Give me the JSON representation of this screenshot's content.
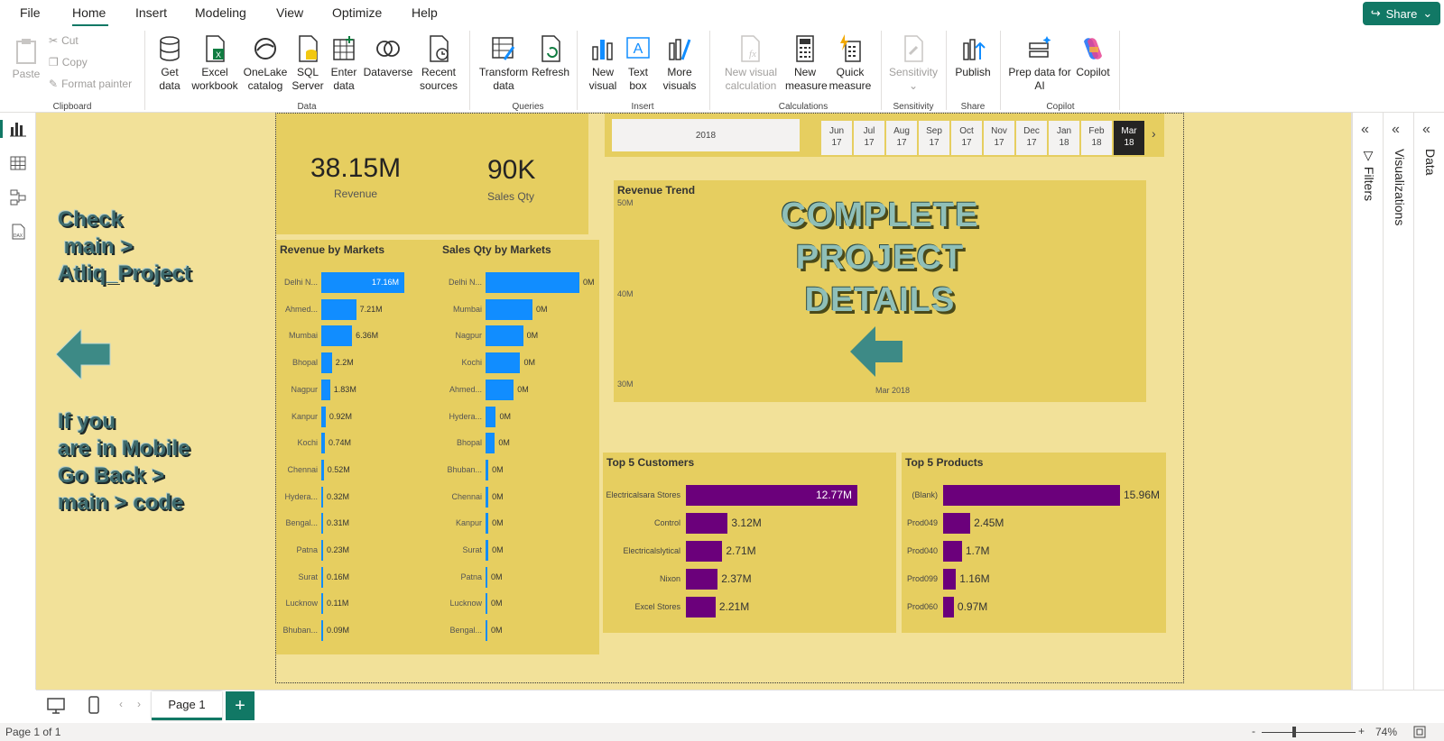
{
  "menu": {
    "file": "File",
    "home": "Home",
    "insert": "Insert",
    "modeling": "Modeling",
    "view": "View",
    "optimize": "Optimize",
    "help": "Help",
    "share": "Share"
  },
  "ribbon": {
    "paste": "Paste",
    "cut": "Cut",
    "copy": "Copy",
    "format_painter": "Format painter",
    "clipboard": "Clipboard",
    "get_data_1": "Get",
    "get_data_2": "data",
    "excel_1": "Excel",
    "excel_2": "workbook",
    "onelake_1": "OneLake",
    "onelake_2": "catalog",
    "sql_1": "SQL",
    "sql_2": "Server",
    "enter_1": "Enter",
    "enter_2": "data",
    "dataverse": "Dataverse",
    "recent_1": "Recent",
    "recent_2": "sources",
    "data_group": "Data",
    "transform_1": "Transform",
    "transform_2": "data",
    "refresh": "Refresh",
    "queries": "Queries",
    "new_visual_1": "New",
    "new_visual_2": "visual",
    "text_box_1": "Text",
    "text_box_2": "box",
    "more_visuals_1": "More",
    "more_visuals_2": "visuals",
    "insert_group": "Insert",
    "new_visual_calc_1": "New visual",
    "new_visual_calc_2": "calculation",
    "new_measure_1": "New",
    "new_measure_2": "measure",
    "quick_measure_1": "Quick",
    "quick_measure_2": "measure",
    "calculations": "Calculations",
    "sensitivity_btn": "Sensitivity",
    "sensitivity": "Sensitivity",
    "publish": "Publish",
    "share_group": "Share",
    "prep_1": "Prep data for",
    "prep_2": "AI",
    "copilot_btn": "Copilot",
    "copilot_group": "Copilot"
  },
  "report": {
    "kpi_revenue": "38.15M",
    "kpi_revenue_label": "Revenue",
    "kpi_qty": "90K",
    "kpi_qty_label": "Sales Qty",
    "year_slicer": "2018",
    "months": [
      [
        "Jun",
        "17"
      ],
      [
        "Jul",
        "17"
      ],
      [
        "Aug",
        "17"
      ],
      [
        "Sep",
        "17"
      ],
      [
        "Oct",
        "17"
      ],
      [
        "Nov",
        "17"
      ],
      [
        "Dec",
        "17"
      ],
      [
        "Jan",
        "18"
      ],
      [
        "Feb",
        "18"
      ],
      [
        "Mar",
        "18"
      ]
    ],
    "selected_month_index": 9,
    "note_left_1": "Check\n main >\nAtliq_Project",
    "note_left_2": "If you\nare in Mobile\nGo Back >\nmain > code",
    "project_text": "COMPLETE\nPROJECT\nDETAILS",
    "trend_title": "Revenue Trend",
    "trend_y": [
      "50M",
      "40M",
      "30M"
    ],
    "trend_x": "Mar 2018",
    "rev_markets_title": "Revenue by Markets",
    "qty_markets_title": "Sales Qty by Markets",
    "top_customers_title": "Top 5 Customers",
    "top_products_title": "Top 5 Products",
    "page_tab": "Page 1",
    "status": "Page 1 of 1",
    "zoom": "74%",
    "pane_filters": "Filters",
    "pane_visualizations": "Visualizations",
    "pane_data": "Data"
  },
  "chart_data": [
    {
      "type": "bar",
      "title": "Revenue by Markets",
      "categories": [
        "Delhi N...",
        "Ahmed...",
        "Mumbai",
        "Bhopal",
        "Nagpur",
        "Kanpur",
        "Kochi",
        "Chennai",
        "Hydera...",
        "Bengal...",
        "Patna",
        "Surat",
        "Lucknow",
        "Bhuban..."
      ],
      "values": [
        17.16,
        7.21,
        6.36,
        2.2,
        1.83,
        0.92,
        0.74,
        0.52,
        0.32,
        0.31,
        0.23,
        0.16,
        0.11,
        0.09
      ],
      "labels": [
        "17.16M",
        "7.21M",
        "6.36M",
        "2.2M",
        "1.83M",
        "0.92M",
        "0.74M",
        "0.52M",
        "0.32M",
        "0.31M",
        "0.23M",
        "0.16M",
        "0.11M",
        "0.09M"
      ],
      "color": "#118dff"
    },
    {
      "type": "bar",
      "title": "Sales Qty by Markets",
      "categories": [
        "Delhi N...",
        "Mumbai",
        "Nagpur",
        "Kochi",
        "Ahmed...",
        "Hydera...",
        "Bhopal",
        "Bhuban...",
        "Chennai",
        "Kanpur",
        "Surat",
        "Patna",
        "Lucknow",
        "Bengal..."
      ],
      "values": [
        100,
        50,
        40,
        37,
        30,
        11,
        10,
        3,
        3,
        3,
        3,
        0.5,
        0.5,
        0.5
      ],
      "labels": [
        "0M",
        "0M",
        "0M",
        "0M",
        "0M",
        "0M",
        "0M",
        "0M",
        "0M",
        "0M",
        "0M",
        "0M",
        "0M",
        "0M"
      ],
      "color": "#118dff"
    },
    {
      "type": "bar",
      "title": "Top 5 Customers",
      "categories": [
        "Electricalsara Stores",
        "Control",
        "Electricalslytical",
        "Nixon",
        "Excel Stores"
      ],
      "values": [
        12.77,
        3.12,
        2.71,
        2.37,
        2.21
      ],
      "labels": [
        "12.77M",
        "3.12M",
        "2.71M",
        "2.37M",
        "2.21M"
      ],
      "color": "#6b007b"
    },
    {
      "type": "bar",
      "title": "Top 5 Products",
      "categories": [
        "(Blank)",
        "Prod049",
        "Prod040",
        "Prod099",
        "Prod060"
      ],
      "values": [
        15.96,
        2.45,
        1.7,
        1.16,
        0.97
      ],
      "labels": [
        "15.96M",
        "2.45M",
        "1.7M",
        "1.16M",
        "0.97M"
      ],
      "color": "#6b007b"
    },
    {
      "type": "line",
      "title": "Revenue Trend",
      "x": [
        "Mar 2018"
      ],
      "ylabels": [
        "50M",
        "40M",
        "30M"
      ]
    }
  ]
}
